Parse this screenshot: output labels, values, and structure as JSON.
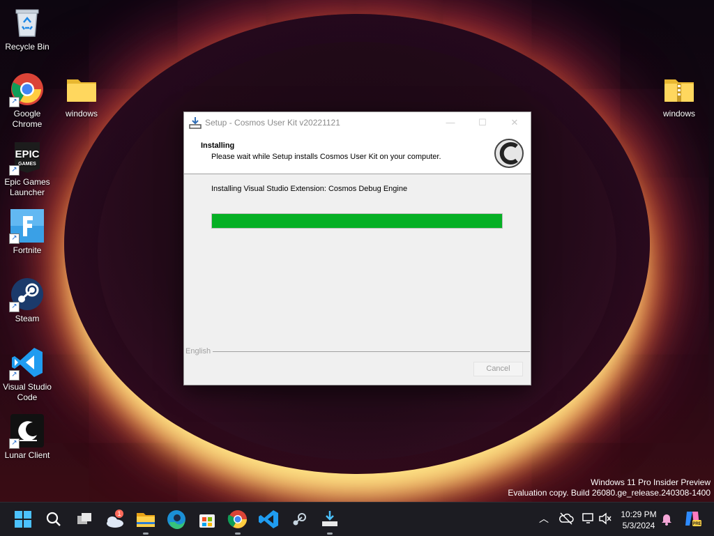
{
  "desktop": {
    "icons": [
      {
        "label": "Recycle Bin"
      },
      {
        "label": "Google\nChrome"
      },
      {
        "label": "windows"
      },
      {
        "label": "Epic Games\nLauncher"
      },
      {
        "label": "Fortnite"
      },
      {
        "label": "Steam"
      },
      {
        "label": "Visual Studio\nCode"
      },
      {
        "label": "Lunar Client"
      },
      {
        "label": "windows"
      }
    ],
    "watermark": {
      "line1": "Windows 11 Pro Insider Preview",
      "line2": "Evaluation copy. Build 26080.ge_release.240308-1400"
    }
  },
  "setup_window": {
    "title": "Setup - Cosmos User Kit v20221121",
    "header_title": "Installing",
    "header_subtitle": "Please wait while Setup installs Cosmos User Kit on your computer.",
    "status_text": "Installing Visual Studio Extension: Cosmos Debug Engine",
    "progress_fraction": 1.0,
    "progress_color": "#06b025",
    "language": "English",
    "cancel_label": "Cancel"
  },
  "taskbar": {
    "weather_badge": "1",
    "clock_time": "10:29 PM",
    "clock_date": "5/3/2024",
    "apps": [
      "start-icon",
      "search-icon",
      "task-view-icon",
      "weather-icon",
      "file-explorer-icon",
      "edge-icon",
      "store-icon",
      "chrome-icon",
      "vscode-icon",
      "steam-icon",
      "installer-icon"
    ]
  }
}
